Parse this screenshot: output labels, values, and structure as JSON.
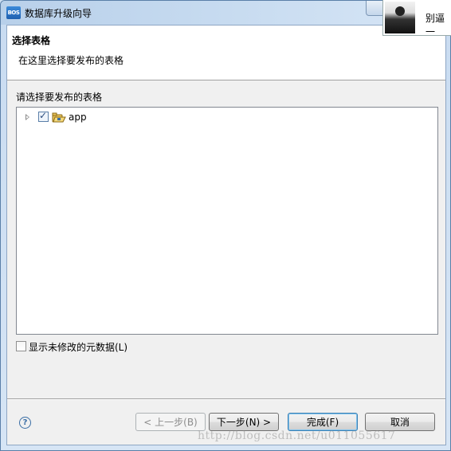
{
  "window": {
    "title": "数据库升级向导",
    "app_icon_text": "BOS"
  },
  "popup": {
    "text": "别逼一"
  },
  "header": {
    "title": "选择表格",
    "description": "在这里选择要发布的表格"
  },
  "tree_section": {
    "label": "请选择要发布的表格",
    "items": [
      {
        "label": "app",
        "checked": true,
        "icon": "database-folder-icon"
      }
    ]
  },
  "options": {
    "show_unmodified_label": "显示未修改的元数据(L)",
    "show_unmodified_checked": false
  },
  "buttons": {
    "prev": "< 上一步(B)",
    "next": "下一步(N) >",
    "finish": "完成(F)",
    "cancel": "取消"
  },
  "watermark": "http://blog.csdn.net/u011055617"
}
